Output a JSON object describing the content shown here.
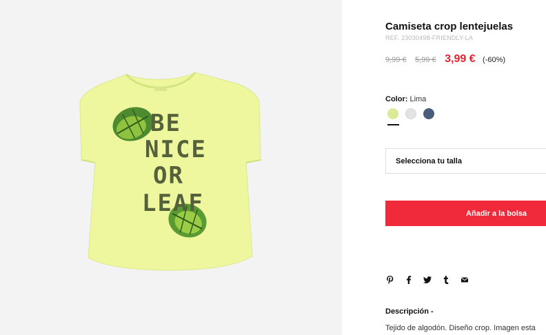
{
  "product": {
    "title": "Camiseta crop lentejuelas",
    "ref": "REF. 23030498-FRIENDLY-LA",
    "image": {
      "print_lines": [
        "BE",
        "NICE",
        "OR",
        "LEAF"
      ]
    }
  },
  "pricing": {
    "old_price_1": "9,99 €",
    "old_price_2": "5,99 €",
    "current_price": "3,99 €",
    "discount": "(-60%)",
    "current_price_color": "#e8202f"
  },
  "color": {
    "label": "Color:",
    "value": "Lima",
    "swatches": [
      {
        "name": "Lima",
        "color": "#d9eb96",
        "selected": true
      },
      {
        "name": "Gris",
        "color": "#e3e3e3",
        "selected": false
      },
      {
        "name": "Azul",
        "color": "#4a5d7a",
        "selected": false
      }
    ]
  },
  "size": {
    "placeholder": "Selecciona tu talla"
  },
  "actions": {
    "add_to_bag": "Añadir a la bolsa",
    "button_color": "#f02a3a"
  },
  "share": {
    "icons": [
      "pinterest-icon",
      "facebook-icon",
      "twitter-icon",
      "tumblr-icon",
      "email-icon"
    ]
  },
  "description": {
    "title": "Descripción -",
    "text": "Tejido de algodón. Diseño crop. Imagen esta"
  }
}
